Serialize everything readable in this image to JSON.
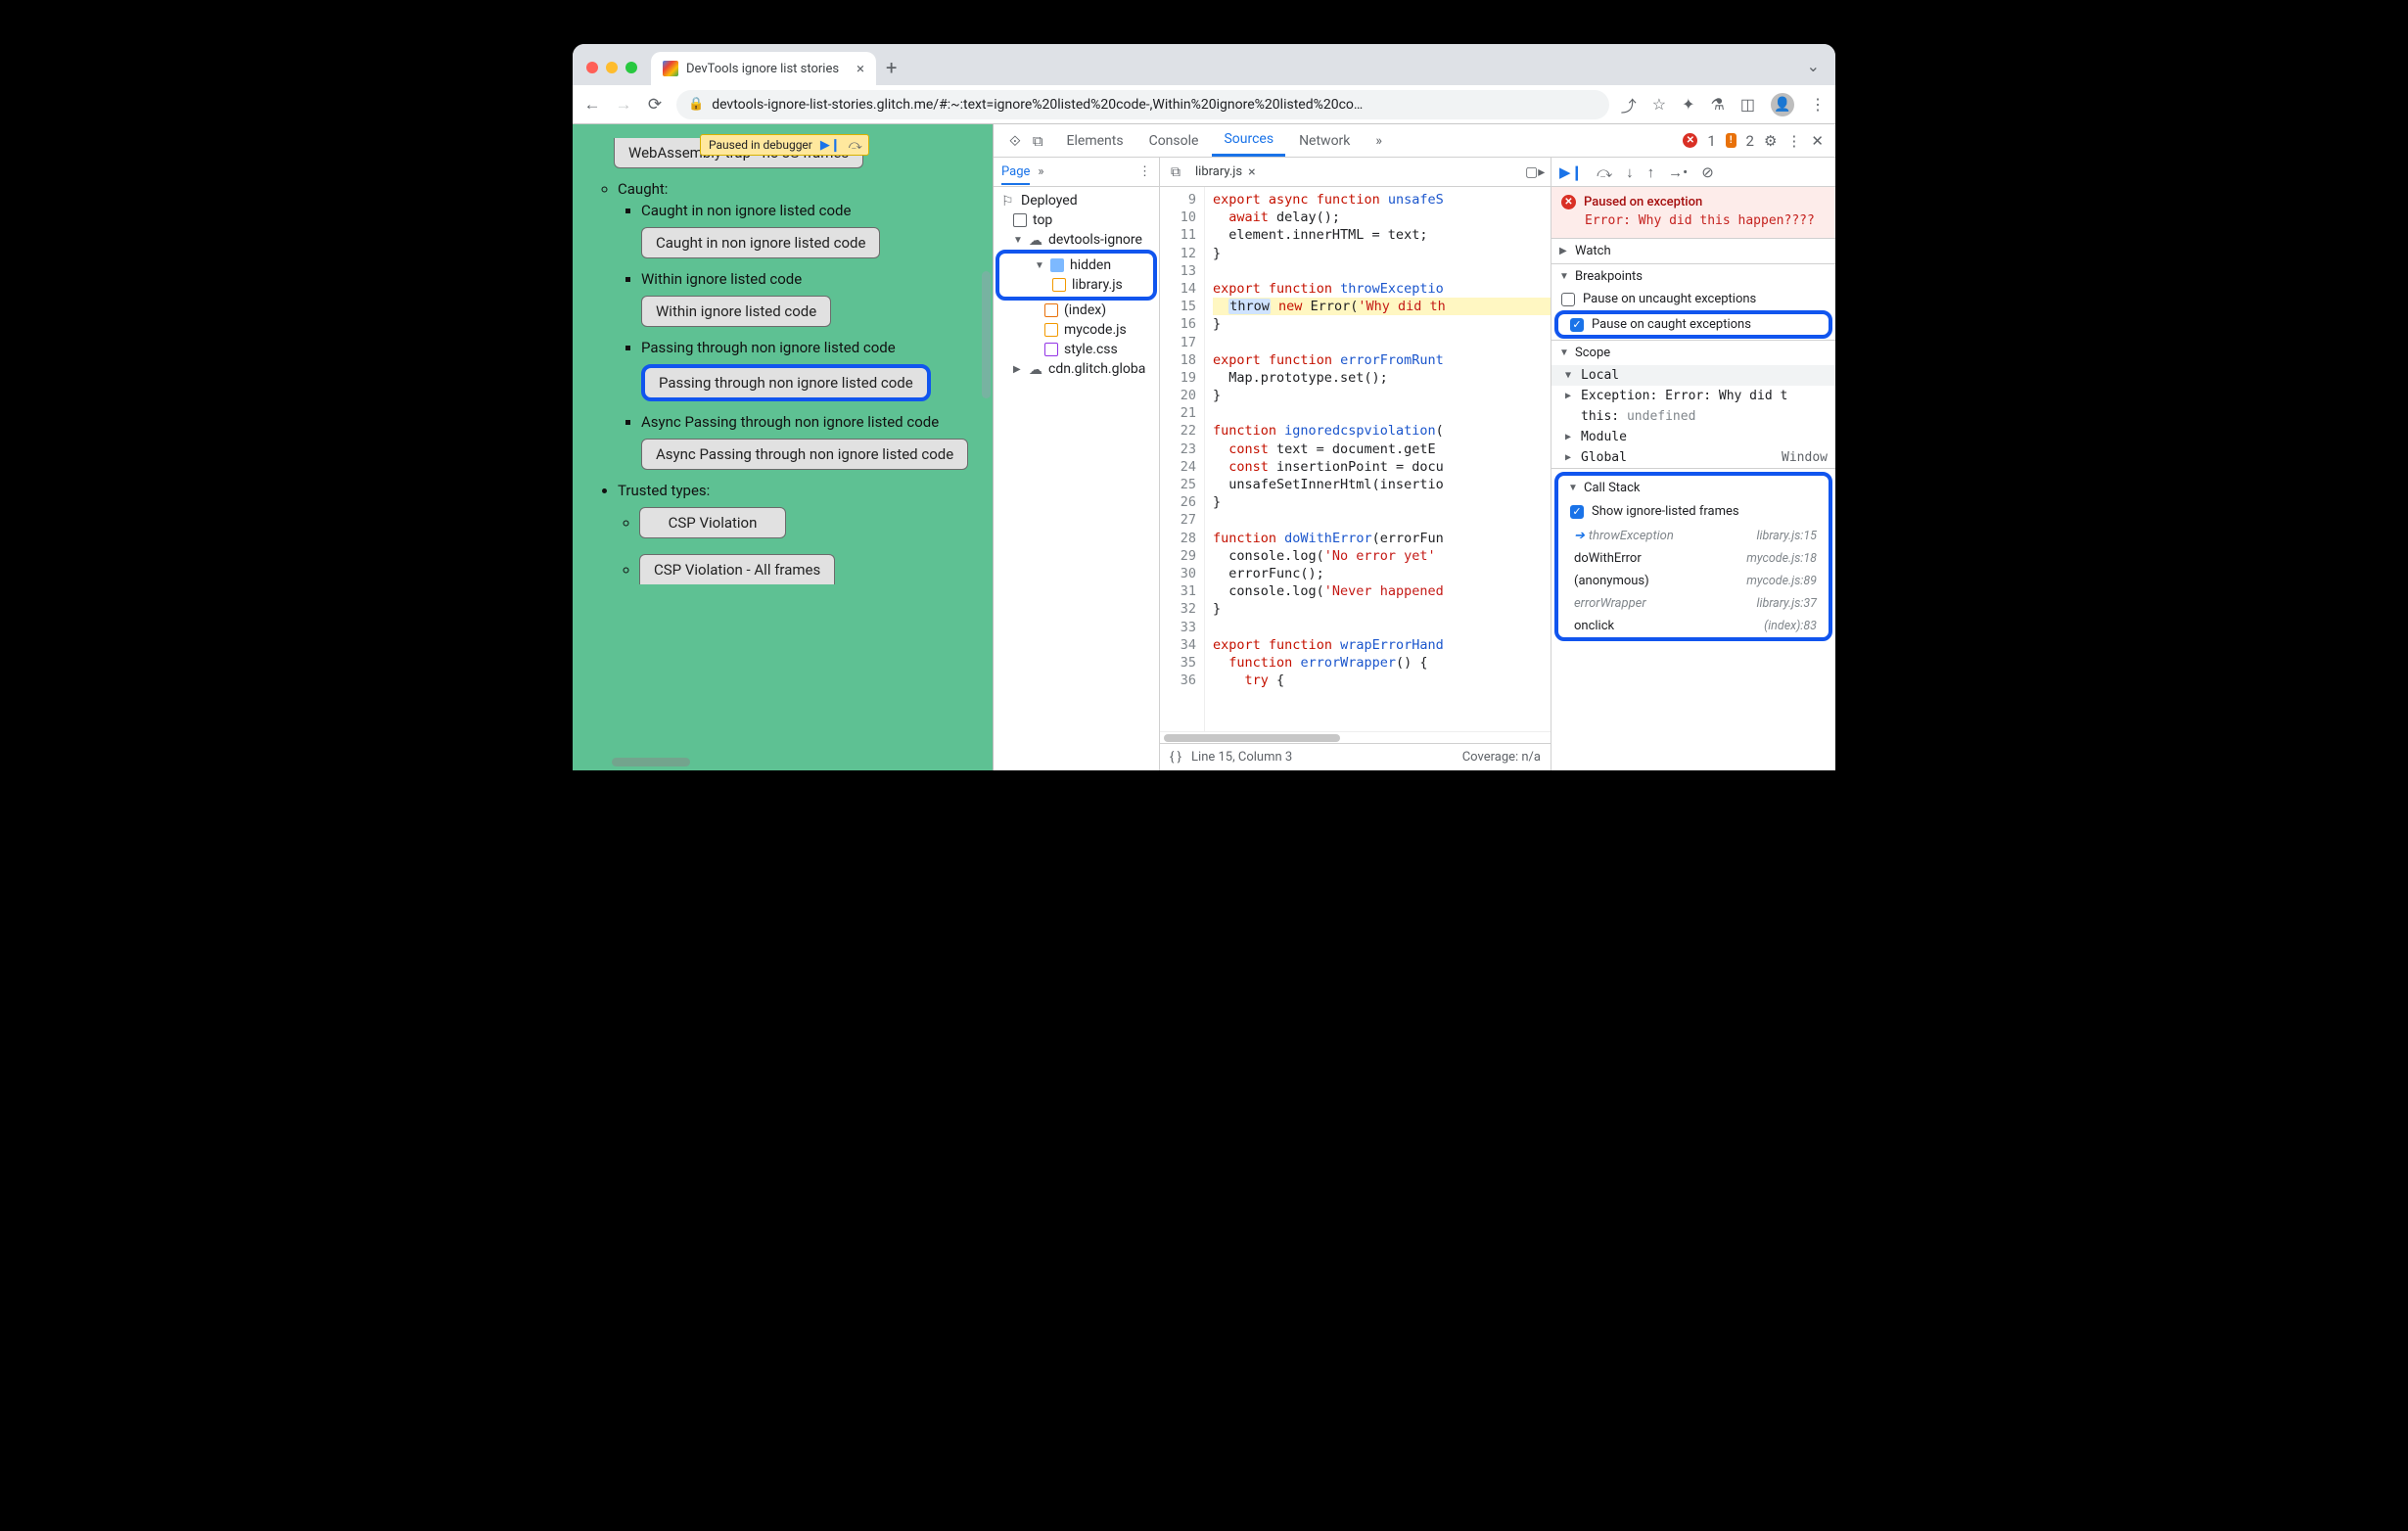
{
  "tab": {
    "title": "DevTools ignore list stories"
  },
  "url": "devtools-ignore-list-stories.glitch.me/#:~:text=ignore%20listed%20code-,Within%20ignore%20listed%20co…",
  "paused_pill": "Paused in debugger",
  "page": {
    "btn_wasm": "WebAssembly trap - no JS frames",
    "caught": "Caught:",
    "li1": "Caught in non ignore listed code",
    "btn1": "Caught in non ignore listed code",
    "li2": "Within ignore listed code",
    "btn2": "Within ignore listed code",
    "li3": "Passing through non ignore listed code",
    "btn3": "Passing through non ignore listed code",
    "li4": "Async Passing through non ignore listed code",
    "btn4": "Async Passing through non ignore listed code",
    "trusted": "Trusted types:",
    "btn5": "CSP Violation",
    "btn6": "CSP Violation - All frames"
  },
  "devtools": {
    "tabs": {
      "elements": "Elements",
      "console": "Console",
      "sources": "Sources",
      "network": "Network"
    },
    "err_count": "1",
    "warn_count": "2",
    "nav": {
      "page": "Page",
      "deployed": "Deployed",
      "top": "top",
      "origin": "devtools-ignore",
      "hidden": "hidden",
      "library": "library.js",
      "index": "(index)",
      "mycode": "mycode.js",
      "style": "style.css",
      "cdn": "cdn.glitch.globa"
    },
    "editor": {
      "filename": "library.js",
      "status_left": "Line 15, Column 3",
      "status_right": "Coverage: n/a",
      "lines": [
        {
          "n": 9,
          "html": "<span class='kw'>export</span> <span class='kw'>async</span> <span class='kw'>function</span> <span class='fn2'>unsafeS</span>"
        },
        {
          "n": 10,
          "html": "  <span class='kw'>await</span> delay();"
        },
        {
          "n": 11,
          "html": "  element.innerHTML = text;"
        },
        {
          "n": 12,
          "html": "}"
        },
        {
          "n": 13,
          "html": ""
        },
        {
          "n": 14,
          "html": "<span class='kw'>export</span> <span class='kw'>function</span> <span class='fn2'>throwExceptio</span>"
        },
        {
          "n": 15,
          "hl": true,
          "html": "  <span class='tok-sel'>throw</span> <span class='kw'>new</span> Error(<span class='str'>'Why did th</span>"
        },
        {
          "n": 16,
          "html": "}"
        },
        {
          "n": 17,
          "html": ""
        },
        {
          "n": 18,
          "html": "<span class='kw'>export</span> <span class='kw'>function</span> <span class='fn2'>errorFromRunt</span>"
        },
        {
          "n": 19,
          "html": "  Map.prototype.set();"
        },
        {
          "n": 20,
          "html": "}"
        },
        {
          "n": 21,
          "html": ""
        },
        {
          "n": 22,
          "html": "<span class='kw'>function</span> <span class='fn2'>ignoredcspviolation</span>("
        },
        {
          "n": 23,
          "html": "  <span class='kw'>const</span> text = document.getE"
        },
        {
          "n": 24,
          "html": "  <span class='kw'>const</span> insertionPoint = docu"
        },
        {
          "n": 25,
          "html": "  unsafeSetInnerHtml(insertio"
        },
        {
          "n": 26,
          "html": "}"
        },
        {
          "n": 27,
          "html": ""
        },
        {
          "n": 28,
          "html": "<span class='kw'>function</span> <span class='fn2'>doWithError</span>(errorFun"
        },
        {
          "n": 29,
          "html": "  console.log(<span class='str'>'No error yet'</span>"
        },
        {
          "n": 30,
          "html": "  errorFunc();"
        },
        {
          "n": 31,
          "html": "  console.log(<span class='str'>'Never happened</span>"
        },
        {
          "n": 32,
          "html": "}"
        },
        {
          "n": 33,
          "html": ""
        },
        {
          "n": 34,
          "html": "<span class='kw'>export</span> <span class='kw'>function</span> <span class='fn2'>wrapErrorHand</span>"
        },
        {
          "n": 35,
          "html": "  <span class='kw'>function</span> <span class='fn2'>errorWrapper</span>() {"
        },
        {
          "n": 36,
          "html": "    <span class='kw'>try</span> {"
        }
      ]
    },
    "dbg": {
      "paused_title": "Paused on exception",
      "paused_err": "Error: Why did this happen????",
      "watch": "Watch",
      "breakpoints": "Breakpoints",
      "bp_uncaught": "Pause on uncaught exceptions",
      "bp_caught": "Pause on caught exceptions",
      "scope": "Scope",
      "local": "Local",
      "exception": "Exception: Error: Why did t",
      "this": "this: ",
      "undefined": "undefined",
      "module": "Module",
      "global": "Global",
      "window": "Window",
      "callstack": "Call Stack",
      "show_ignored": "Show ignore-listed frames",
      "frames": [
        {
          "fn": "throwException",
          "loc": "library.js:15",
          "ign": true,
          "current": true
        },
        {
          "fn": "doWithError",
          "loc": "mycode.js:18"
        },
        {
          "fn": "(anonymous)",
          "loc": "mycode.js:89"
        },
        {
          "fn": "errorWrapper",
          "loc": "library.js:37",
          "ign": true
        },
        {
          "fn": "onclick",
          "loc": "(index):83"
        }
      ]
    }
  }
}
